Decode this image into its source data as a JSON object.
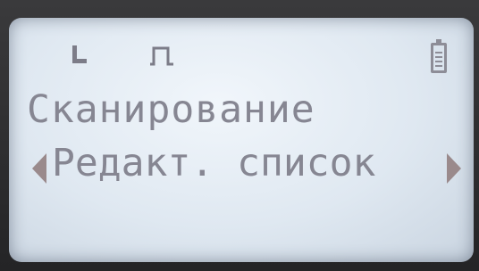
{
  "status": {
    "icons": [
      "l-mode-icon",
      "pulse-icon",
      "battery-icon"
    ],
    "battery_level": 1.0
  },
  "screen": {
    "title": "Сканирование",
    "menu_item": "Редакт. список"
  },
  "colors": {
    "lcd_background": "#e4ecf4",
    "lcd_text": "#868692",
    "arrow": "#9a8a8c"
  }
}
